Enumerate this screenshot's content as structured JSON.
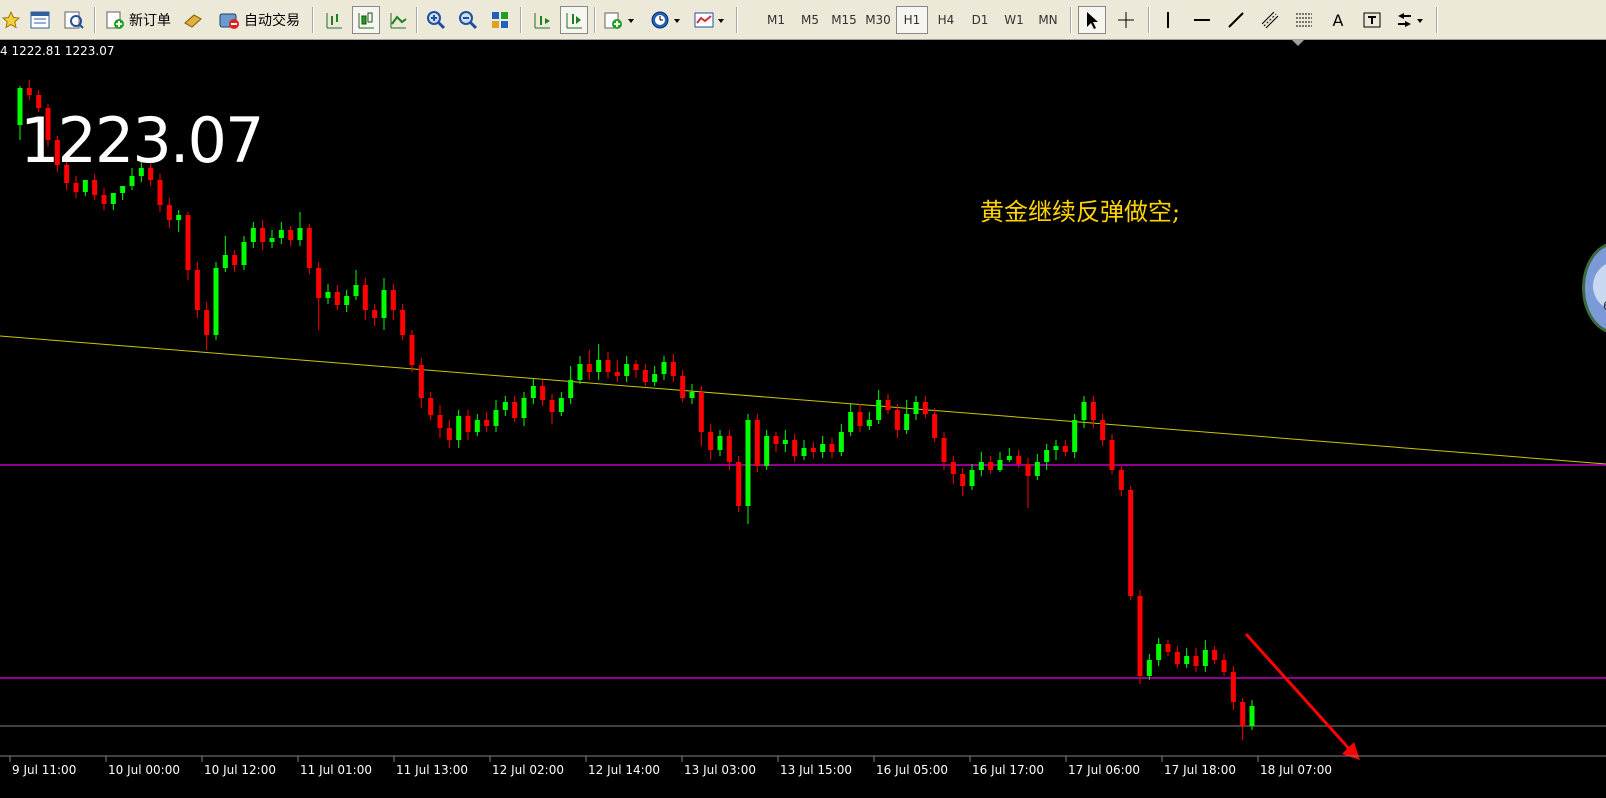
{
  "toolbar": {
    "new_order_label": "新订单",
    "auto_trade_label": "自动交易",
    "timeframes": [
      "M1",
      "M5",
      "M15",
      "M30",
      "H1",
      "H4",
      "D1",
      "W1",
      "MN"
    ],
    "active_timeframe": "H1",
    "text_tool_label": "A"
  },
  "chart": {
    "ohlc_text": "4 1222.81 1223.07",
    "big_price": "1223.07",
    "annotation": "黄金继续反弹做空;",
    "widget_text": "6",
    "x_labels": [
      "9 Jul 11:00",
      "10 Jul 00:00",
      "10 Jul 12:00",
      "11 Jul 01:00",
      "11 Jul 13:00",
      "12 Jul 02:00",
      "12 Jul 14:00",
      "13 Jul 03:00",
      "13 Jul 15:00",
      "16 Jul 05:00",
      "16 Jul 17:00",
      "17 Jul 06:00",
      "17 Jul 18:00",
      "18 Jul 07:00"
    ],
    "colors": {
      "bull": "#00ff00",
      "bear": "#ff0000",
      "trendline": "#c8c800",
      "support": "#c000c0",
      "price_line": "#808080",
      "arrow": "#ff0000",
      "annotation": "#ffd400"
    }
  },
  "chart_data": {
    "type": "candlestick",
    "title": "",
    "last_price": 1223.07,
    "x_tick_labels": [
      "9 Jul 11:00",
      "10 Jul 00:00",
      "10 Jul 12:00",
      "11 Jul 01:00",
      "11 Jul 13:00",
      "12 Jul 02:00",
      "12 Jul 14:00",
      "13 Jul 03:00",
      "13 Jul 15:00",
      "16 Jul 05:00",
      "16 Jul 17:00",
      "17 Jul 06:00",
      "17 Jul 18:00",
      "18 Jul 07:00"
    ],
    "overlays": [
      "descending trendline",
      "horizontal line",
      "horizontal line",
      "current price line",
      "down arrow"
    ],
    "grid": false,
    "ohlc_shape": [
      [
        125,
        88,
        140,
        86
      ],
      [
        88,
        95,
        80,
        100
      ],
      [
        95,
        108,
        90,
        112
      ],
      [
        108,
        140,
        104,
        146
      ],
      [
        140,
        165,
        136,
        172
      ],
      [
        165,
        183,
        158,
        190
      ],
      [
        183,
        192,
        176,
        198
      ],
      [
        192,
        180,
        186,
        196
      ],
      [
        180,
        195,
        174,
        200
      ],
      [
        195,
        204,
        188,
        210
      ],
      [
        204,
        193,
        196,
        210
      ],
      [
        193,
        186,
        188,
        200
      ],
      [
        186,
        176,
        168,
        190
      ],
      [
        176,
        168,
        162,
        182
      ],
      [
        168,
        180,
        160,
        186
      ],
      [
        180,
        205,
        174,
        212
      ],
      [
        205,
        220,
        198,
        228
      ],
      [
        220,
        215,
        210,
        232
      ],
      [
        215,
        270,
        212,
        280
      ],
      [
        270,
        310,
        262,
        318
      ],
      [
        310,
        335,
        302,
        350
      ],
      [
        335,
        268,
        262,
        340
      ],
      [
        268,
        255,
        236,
        272
      ],
      [
        255,
        265,
        250,
        272
      ],
      [
        265,
        242,
        236,
        270
      ],
      [
        242,
        228,
        222,
        248
      ],
      [
        228,
        242,
        220,
        250
      ],
      [
        242,
        238,
        230,
        248
      ],
      [
        238,
        230,
        222,
        244
      ],
      [
        230,
        240,
        226,
        246
      ],
      [
        240,
        228,
        212,
        246
      ],
      [
        228,
        268,
        224,
        274
      ],
      [
        268,
        298,
        262,
        330
      ],
      [
        298,
        292,
        284,
        304
      ],
      [
        292,
        305,
        285,
        310
      ],
      [
        305,
        296,
        290,
        312
      ],
      [
        296,
        285,
        270,
        300
      ],
      [
        285,
        310,
        278,
        320
      ],
      [
        310,
        318,
        304,
        326
      ],
      [
        318,
        290,
        278,
        330
      ],
      [
        290,
        310,
        284,
        320
      ],
      [
        310,
        335,
        304,
        340
      ],
      [
        335,
        365,
        330,
        372
      ],
      [
        365,
        398,
        358,
        408
      ],
      [
        398,
        415,
        392,
        420
      ],
      [
        415,
        428,
        405,
        438
      ],
      [
        428,
        440,
        420,
        448
      ],
      [
        440,
        416,
        410,
        448
      ],
      [
        416,
        432,
        410,
        440
      ],
      [
        432,
        420,
        414,
        436
      ],
      [
        420,
        426,
        412,
        432
      ],
      [
        426,
        410,
        400,
        432
      ],
      [
        410,
        402,
        396,
        416
      ],
      [
        402,
        418,
        396,
        422
      ],
      [
        418,
        398,
        392,
        426
      ],
      [
        398,
        386,
        378,
        404
      ],
      [
        386,
        400,
        380,
        406
      ],
      [
        400,
        412,
        394,
        424
      ],
      [
        412,
        398,
        392,
        416
      ],
      [
        398,
        380,
        366,
        404
      ],
      [
        380,
        364,
        356,
        384
      ],
      [
        364,
        372,
        350,
        380
      ],
      [
        372,
        360,
        344,
        380
      ],
      [
        360,
        372,
        352,
        378
      ],
      [
        372,
        376,
        360,
        382
      ],
      [
        376,
        364,
        356,
        382
      ],
      [
        364,
        370,
        360,
        378
      ],
      [
        370,
        382,
        364,
        386
      ],
      [
        382,
        374,
        366,
        386
      ],
      [
        374,
        362,
        356,
        380
      ],
      [
        362,
        376,
        354,
        382
      ],
      [
        376,
        398,
        370,
        402
      ],
      [
        398,
        392,
        384,
        404
      ],
      [
        392,
        432,
        386,
        446
      ],
      [
        432,
        450,
        424,
        460
      ],
      [
        450,
        436,
        430,
        456
      ],
      [
        436,
        462,
        430,
        470
      ],
      [
        462,
        506,
        456,
        512
      ],
      [
        506,
        420,
        414,
        524
      ],
      [
        420,
        466,
        414,
        472
      ],
      [
        466,
        436,
        430,
        470
      ],
      [
        436,
        444,
        432,
        452
      ],
      [
        444,
        440,
        430,
        452
      ],
      [
        440,
        456,
        434,
        462
      ],
      [
        456,
        448,
        440,
        460
      ],
      [
        448,
        452,
        442,
        458
      ],
      [
        452,
        444,
        436,
        458
      ],
      [
        444,
        452,
        438,
        458
      ],
      [
        452,
        432,
        424,
        456
      ],
      [
        432,
        412,
        404,
        436
      ],
      [
        412,
        426,
        404,
        432
      ],
      [
        426,
        420,
        412,
        430
      ],
      [
        420,
        400,
        390,
        424
      ],
      [
        400,
        410,
        394,
        414
      ],
      [
        410,
        430,
        404,
        438
      ],
      [
        430,
        414,
        400,
        434
      ],
      [
        414,
        402,
        396,
        420
      ],
      [
        402,
        414,
        396,
        418
      ],
      [
        414,
        438,
        408,
        442
      ],
      [
        438,
        462,
        432,
        470
      ],
      [
        462,
        474,
        456,
        484
      ],
      [
        474,
        486,
        468,
        496
      ],
      [
        486,
        470,
        464,
        490
      ],
      [
        470,
        462,
        452,
        476
      ],
      [
        462,
        470,
        456,
        474
      ],
      [
        470,
        460,
        452,
        472
      ],
      [
        460,
        456,
        448,
        462
      ],
      [
        456,
        464,
        450,
        468
      ],
      [
        464,
        476,
        458,
        508
      ],
      [
        476,
        462,
        454,
        480
      ],
      [
        462,
        450,
        444,
        470
      ],
      [
        450,
        446,
        440,
        460
      ],
      [
        446,
        452,
        440,
        456
      ],
      [
        452,
        420,
        414,
        458
      ],
      [
        420,
        402,
        396,
        428
      ],
      [
        402,
        420,
        396,
        428
      ],
      [
        420,
        440,
        414,
        446
      ],
      [
        440,
        470,
        434,
        474
      ],
      [
        470,
        490,
        466,
        496
      ],
      [
        490,
        596,
        486,
        600
      ],
      [
        596,
        676,
        590,
        684
      ],
      [
        676,
        660,
        654,
        680
      ],
      [
        660,
        644,
        638,
        666
      ],
      [
        644,
        652,
        640,
        656
      ],
      [
        652,
        664,
        646,
        668
      ],
      [
        664,
        656,
        648,
        668
      ],
      [
        656,
        666,
        648,
        672
      ],
      [
        666,
        650,
        640,
        672
      ],
      [
        650,
        660,
        646,
        664
      ],
      [
        660,
        672,
        654,
        676
      ],
      [
        672,
        702,
        666,
        710
      ],
      [
        702,
        726,
        698,
        740
      ],
      [
        726,
        706,
        700,
        730
      ]
    ]
  }
}
